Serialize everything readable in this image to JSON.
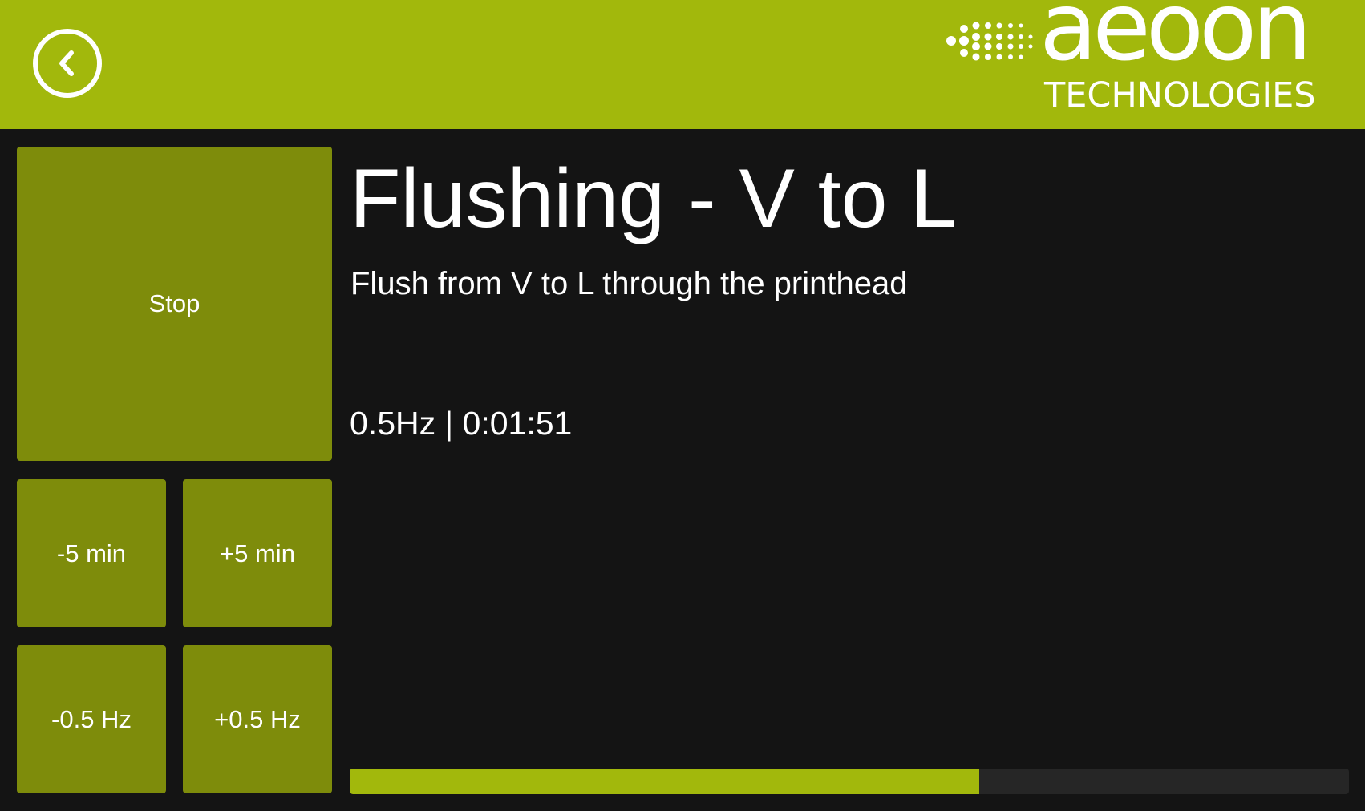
{
  "header": {
    "back_icon": "chevron-left-icon",
    "logo": {
      "word": "aeoon",
      "sub": "TECHNOLOGIES"
    }
  },
  "colors": {
    "header_bg": "#a2b80c",
    "tile_bg": "#7e8c0b",
    "page_bg": "#141414",
    "progress_track": "#262626",
    "progress_fill": "#a2b80c"
  },
  "controls": {
    "stop_label": "Stop",
    "minus_time_label": "-5 min",
    "plus_time_label": "+5 min",
    "minus_freq_label": "-0.5 Hz",
    "plus_freq_label": "+0.5 Hz"
  },
  "main": {
    "title": "Flushing - V to L",
    "description": "Flush from V to L through the printhead",
    "status": "0.5Hz | 0:01:51"
  },
  "progress": {
    "fraction": 0.63
  }
}
